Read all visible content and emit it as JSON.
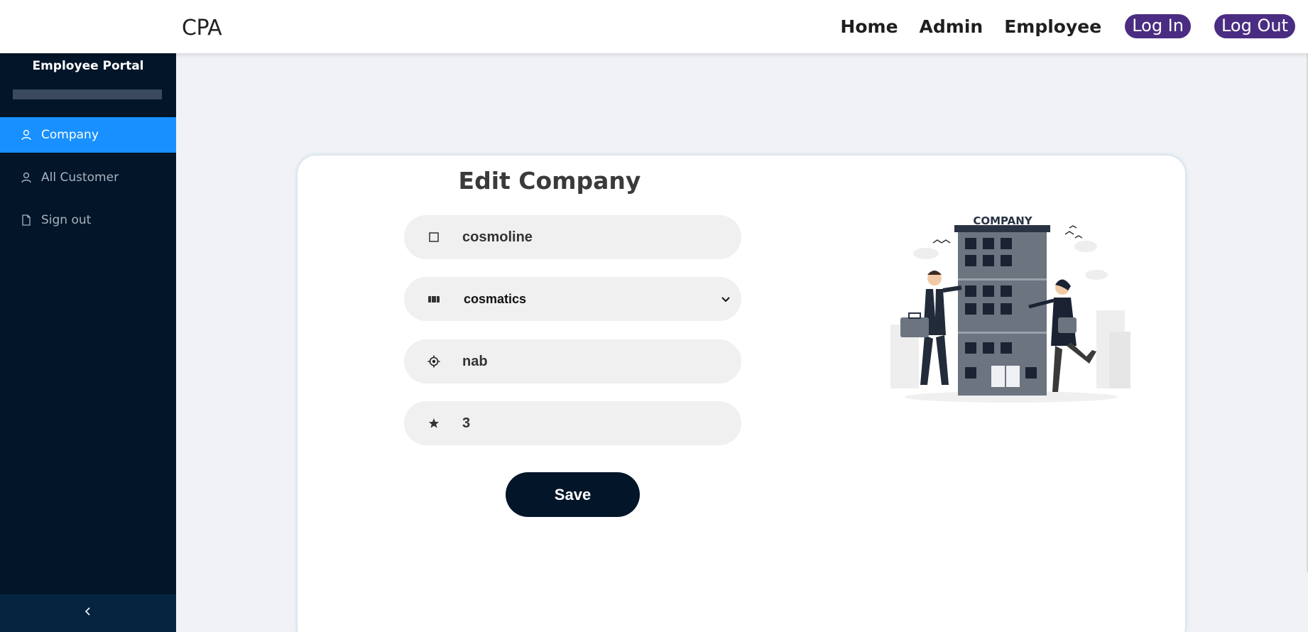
{
  "header": {
    "brand": "CPA",
    "nav": [
      {
        "label": "Home"
      },
      {
        "label": "Admin"
      },
      {
        "label": "Employee"
      }
    ],
    "login_label": "Log In",
    "logout_label": "Log Out"
  },
  "sidebar": {
    "title": "Employee Portal",
    "items": [
      {
        "label": "Company",
        "icon": "user-icon",
        "active": true
      },
      {
        "label": "All Customer",
        "icon": "user-icon",
        "active": false
      },
      {
        "label": "Sign out",
        "icon": "file-icon",
        "active": false
      }
    ],
    "collapse_icon": "chevron-left-icon"
  },
  "form": {
    "title": "Edit Company",
    "name_value": "cosmoline",
    "category_value": "cosmatics",
    "location_value": "nab",
    "rating_value": "3",
    "save_label": "Save"
  },
  "illustration": {
    "sign_text": "COMPANY"
  },
  "colors": {
    "sidebar_bg": "#021529",
    "active_item": "#1890ff",
    "pill": "#4a2d82",
    "save_button": "#021529"
  }
}
